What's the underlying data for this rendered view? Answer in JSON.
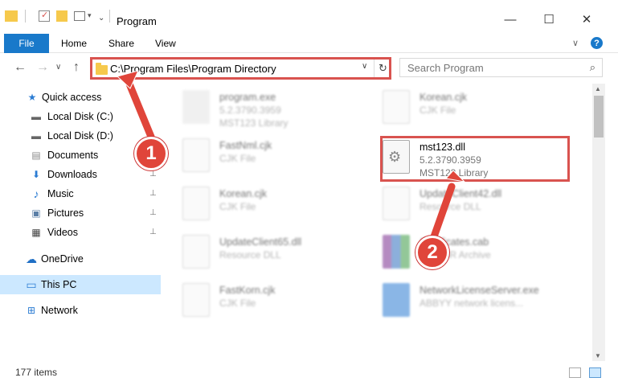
{
  "window": {
    "title": "Program",
    "minimize_glyph": "—",
    "maximize_glyph": "☐",
    "close_glyph": "✕"
  },
  "ribbon": {
    "tabs": [
      "File",
      "Home",
      "Share",
      "View"
    ],
    "collapse_glyph": "∨",
    "help_glyph": "?"
  },
  "nav": {
    "back_glyph": "←",
    "forward_glyph": "→",
    "recent_glyph": "∨",
    "up_glyph": "↑",
    "address": "C:\\Program Files\\Program Directory",
    "address_dropdown_glyph": "∨",
    "refresh_glyph": "↻",
    "search_placeholder": "Search Program",
    "search_glyph": "⌕"
  },
  "sidebar": {
    "items": [
      {
        "label": "Quick access",
        "icon": "star-icon",
        "glyph": "★",
        "pinned": false
      },
      {
        "label": "Local Disk (C:)",
        "icon": "drive-icon",
        "glyph": "▬",
        "pinned": true
      },
      {
        "label": "Local Disk (D:)",
        "icon": "drive-icon",
        "glyph": "▬",
        "pinned": true
      },
      {
        "label": "Documents",
        "icon": "documents-icon",
        "glyph": "▤",
        "pinned": true
      },
      {
        "label": "Downloads",
        "icon": "download-icon",
        "glyph": "⬇",
        "pinned": true
      },
      {
        "label": "Music",
        "icon": "music-icon",
        "glyph": "♪",
        "pinned": true
      },
      {
        "label": "Pictures",
        "icon": "pictures-icon",
        "glyph": "▣",
        "pinned": true
      },
      {
        "label": "Videos",
        "icon": "videos-icon",
        "glyph": "▦",
        "pinned": true
      },
      {
        "label": "OneDrive",
        "icon": "cloud-icon",
        "glyph": "☁",
        "pinned": false
      },
      {
        "label": "This PC",
        "icon": "computer-icon",
        "glyph": "▭",
        "pinned": false,
        "selected": true
      },
      {
        "label": "Network",
        "icon": "network-icon",
        "glyph": "⊞",
        "pinned": false
      }
    ],
    "pin_glyph": "📌"
  },
  "files": [
    {
      "name": "program.exe",
      "type": "5.2.3790.3959",
      "extra": "MST123 Library",
      "blurred": true
    },
    {
      "name": "Korean.cjk",
      "type": "CJK File",
      "blurred": true
    },
    {
      "name": "FastNml.cjk",
      "type": "CJK File",
      "blurred": true
    },
    {
      "name": "mst123.dll",
      "type": "5.2.3790.3959",
      "extra": "MST123 Library",
      "blurred": false
    },
    {
      "name": "Korean.cjk",
      "type": "CJK File",
      "blurred": true
    },
    {
      "name": "UpdateClient42.dll",
      "type": "Resource DLL",
      "blurred": true
    },
    {
      "name": "UpdateClient65.dll",
      "type": "Resource DLL",
      "blurred": true
    },
    {
      "name": "Certificates.cab",
      "type": "WinRAR Archive",
      "blurred": true
    },
    {
      "name": "FastKorn.cjk",
      "type": "CJK File",
      "blurred": true
    },
    {
      "name": "NetworkLicenseServer.exe",
      "type": "ABBYY network licens...",
      "blurred": true
    }
  ],
  "status": {
    "item_count": "177 items"
  },
  "annotations": {
    "step1": "1",
    "step2": "2",
    "color": "#e0453a"
  }
}
